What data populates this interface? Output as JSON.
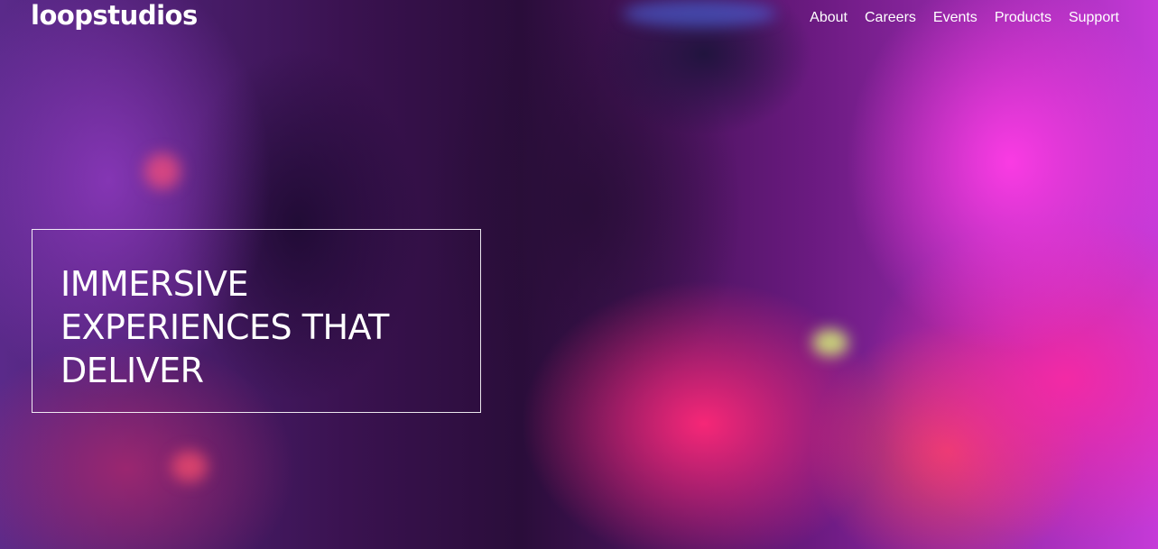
{
  "brand": {
    "logo_text": "loopstudios"
  },
  "nav": {
    "items": [
      {
        "label": "About"
      },
      {
        "label": "Careers"
      },
      {
        "label": "Events"
      },
      {
        "label": "Products"
      },
      {
        "label": "Support"
      }
    ]
  },
  "hero": {
    "headline": "IMMERSIVE EXPERIENCES THAT DELIVER"
  },
  "colors": {
    "text": "#ffffff",
    "accent_magenta": "#ff3ce6",
    "accent_pink": "#ff2878",
    "background_dark": "#2a0d3a"
  }
}
